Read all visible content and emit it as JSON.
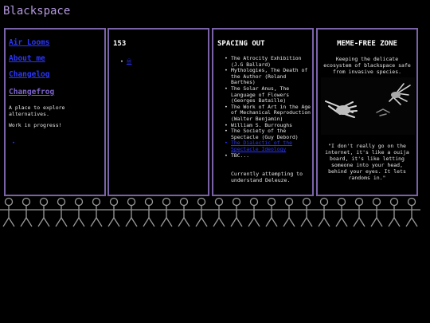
{
  "site": {
    "title": "Blackspace"
  },
  "nav": {
    "links": [
      {
        "label": "Air Looms"
      },
      {
        "label": "About me"
      },
      {
        "label": "Changelog"
      },
      {
        "label": "Changefrog"
      }
    ],
    "description": "A place to explore alternatives.",
    "status": "Work in progress!",
    "bullet": "•"
  },
  "counter": {
    "value": "153",
    "items": [
      {
        "label": "Ⓦ"
      }
    ]
  },
  "reading": {
    "title": "SPACING OUT",
    "items": [
      {
        "label": "The Atrocity Exhibition (J.G Ballard)",
        "link": false
      },
      {
        "label": "Mythologies, The Death of the Author (Roland Barthes)",
        "link": false
      },
      {
        "label": "The Solar Anus, The Language of Flowers (Georges Bataille)",
        "link": false
      },
      {
        "label": "The Work of Art in the Age of Mechanical Reproduction (Walter Benjamin)",
        "link": false
      },
      {
        "label": "William S. Burroughs",
        "link": false
      },
      {
        "label": "The Society of the Spectacle (Guy Debord)",
        "link": false
      },
      {
        "label": "The Dialectic of the Spectacle Ideology",
        "link": true
      },
      {
        "label": "TBC...",
        "link": false
      }
    ],
    "note": "Currently attempting to understand Deleuze."
  },
  "meme": {
    "title": "MEME-FREE ZONE",
    "caption": "Keeping the delicate ecosystem of blackspace safe from invasive species.",
    "quote": "\"I don't really go on the internet, it's like a ouija board, it's like letting someone into your head, behind your eyes. It lets randoms in.\""
  },
  "colors": {
    "background": "#000000",
    "border": "#7a62a8",
    "title": "#b59adf",
    "link": "#2a35ff",
    "visited": "#7d63cc"
  },
  "icons": {
    "paperdoll_band": "paper-doll-figures-icon",
    "meme_image": "reaching-hands-icon"
  }
}
